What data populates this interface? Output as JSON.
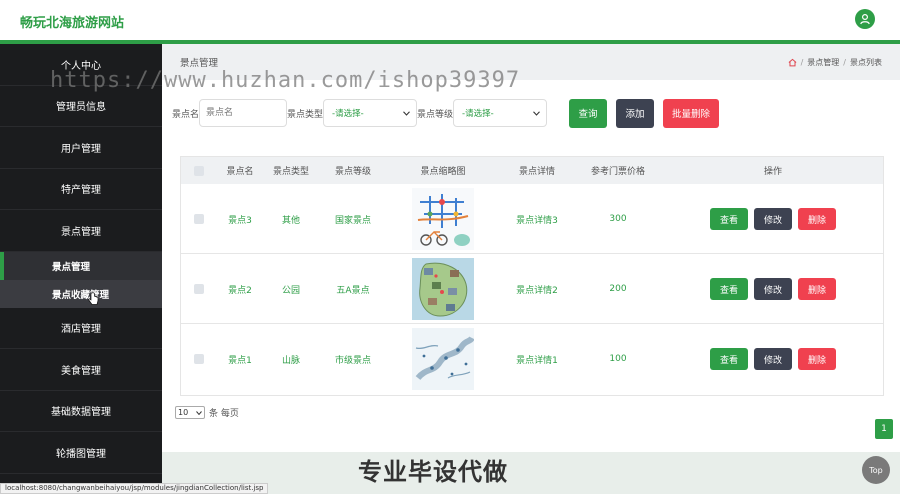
{
  "app": {
    "title": "畅玩北海旅游网站"
  },
  "sidebar": {
    "items": [
      {
        "label": "个人中心"
      },
      {
        "label": "管理员信息"
      },
      {
        "label": "用户管理"
      },
      {
        "label": "特产管理"
      },
      {
        "label": "景点管理"
      }
    ],
    "sub_items": [
      {
        "label": "景点管理"
      },
      {
        "label": "景点收藏管理"
      }
    ],
    "items_after": [
      {
        "label": "酒店管理"
      },
      {
        "label": "美食管理"
      },
      {
        "label": "基础数据管理"
      },
      {
        "label": "轮播图管理"
      }
    ]
  },
  "header": {
    "page_title": "景点管理",
    "breadcrumb": [
      "景点管理",
      "景点列表"
    ]
  },
  "search": {
    "name_label": "景点名",
    "name_placeholder": "景点名",
    "type_label": "景点类型",
    "type_value": "-请选择-",
    "level_label": "景点等级",
    "level_value": "-请选择-",
    "query_button": "查询",
    "add_button": "添加",
    "batch_delete_button": "批量删除"
  },
  "table": {
    "headers": [
      "景点名",
      "景点类型",
      "景点等级",
      "景点缩略图",
      "景点详情",
      "参考门票价格",
      "操作"
    ],
    "rows": [
      {
        "name": "景点3",
        "type": "其他",
        "level": "国家景点",
        "detail": "景点详情3",
        "price": "300"
      },
      {
        "name": "景点2",
        "type": "公园",
        "level": "五A景点",
        "detail": "景点详情2",
        "price": "200"
      },
      {
        "name": "景点1",
        "type": "山脉",
        "level": "市级景点",
        "detail": "景点详情1",
        "price": "100"
      }
    ],
    "actions": {
      "view": "查看",
      "edit": "修改",
      "delete": "删除"
    }
  },
  "pagination": {
    "page_size": "10",
    "per_page_label": "条 每页",
    "current_page": "1"
  },
  "overlay": {
    "watermark": "https://www.huzhan.com/ishop39397",
    "caption": "专业毕设代做",
    "top_button": "Top"
  },
  "status_url": "localhost:8080/changwanbeihaiyou/jsp/modules/jingdianCollection/list.jsp",
  "colors": {
    "accent": "#2e9e47",
    "dark": "#3d4251",
    "danger": "#f0414f",
    "sidebar": "#1b1c1e"
  }
}
